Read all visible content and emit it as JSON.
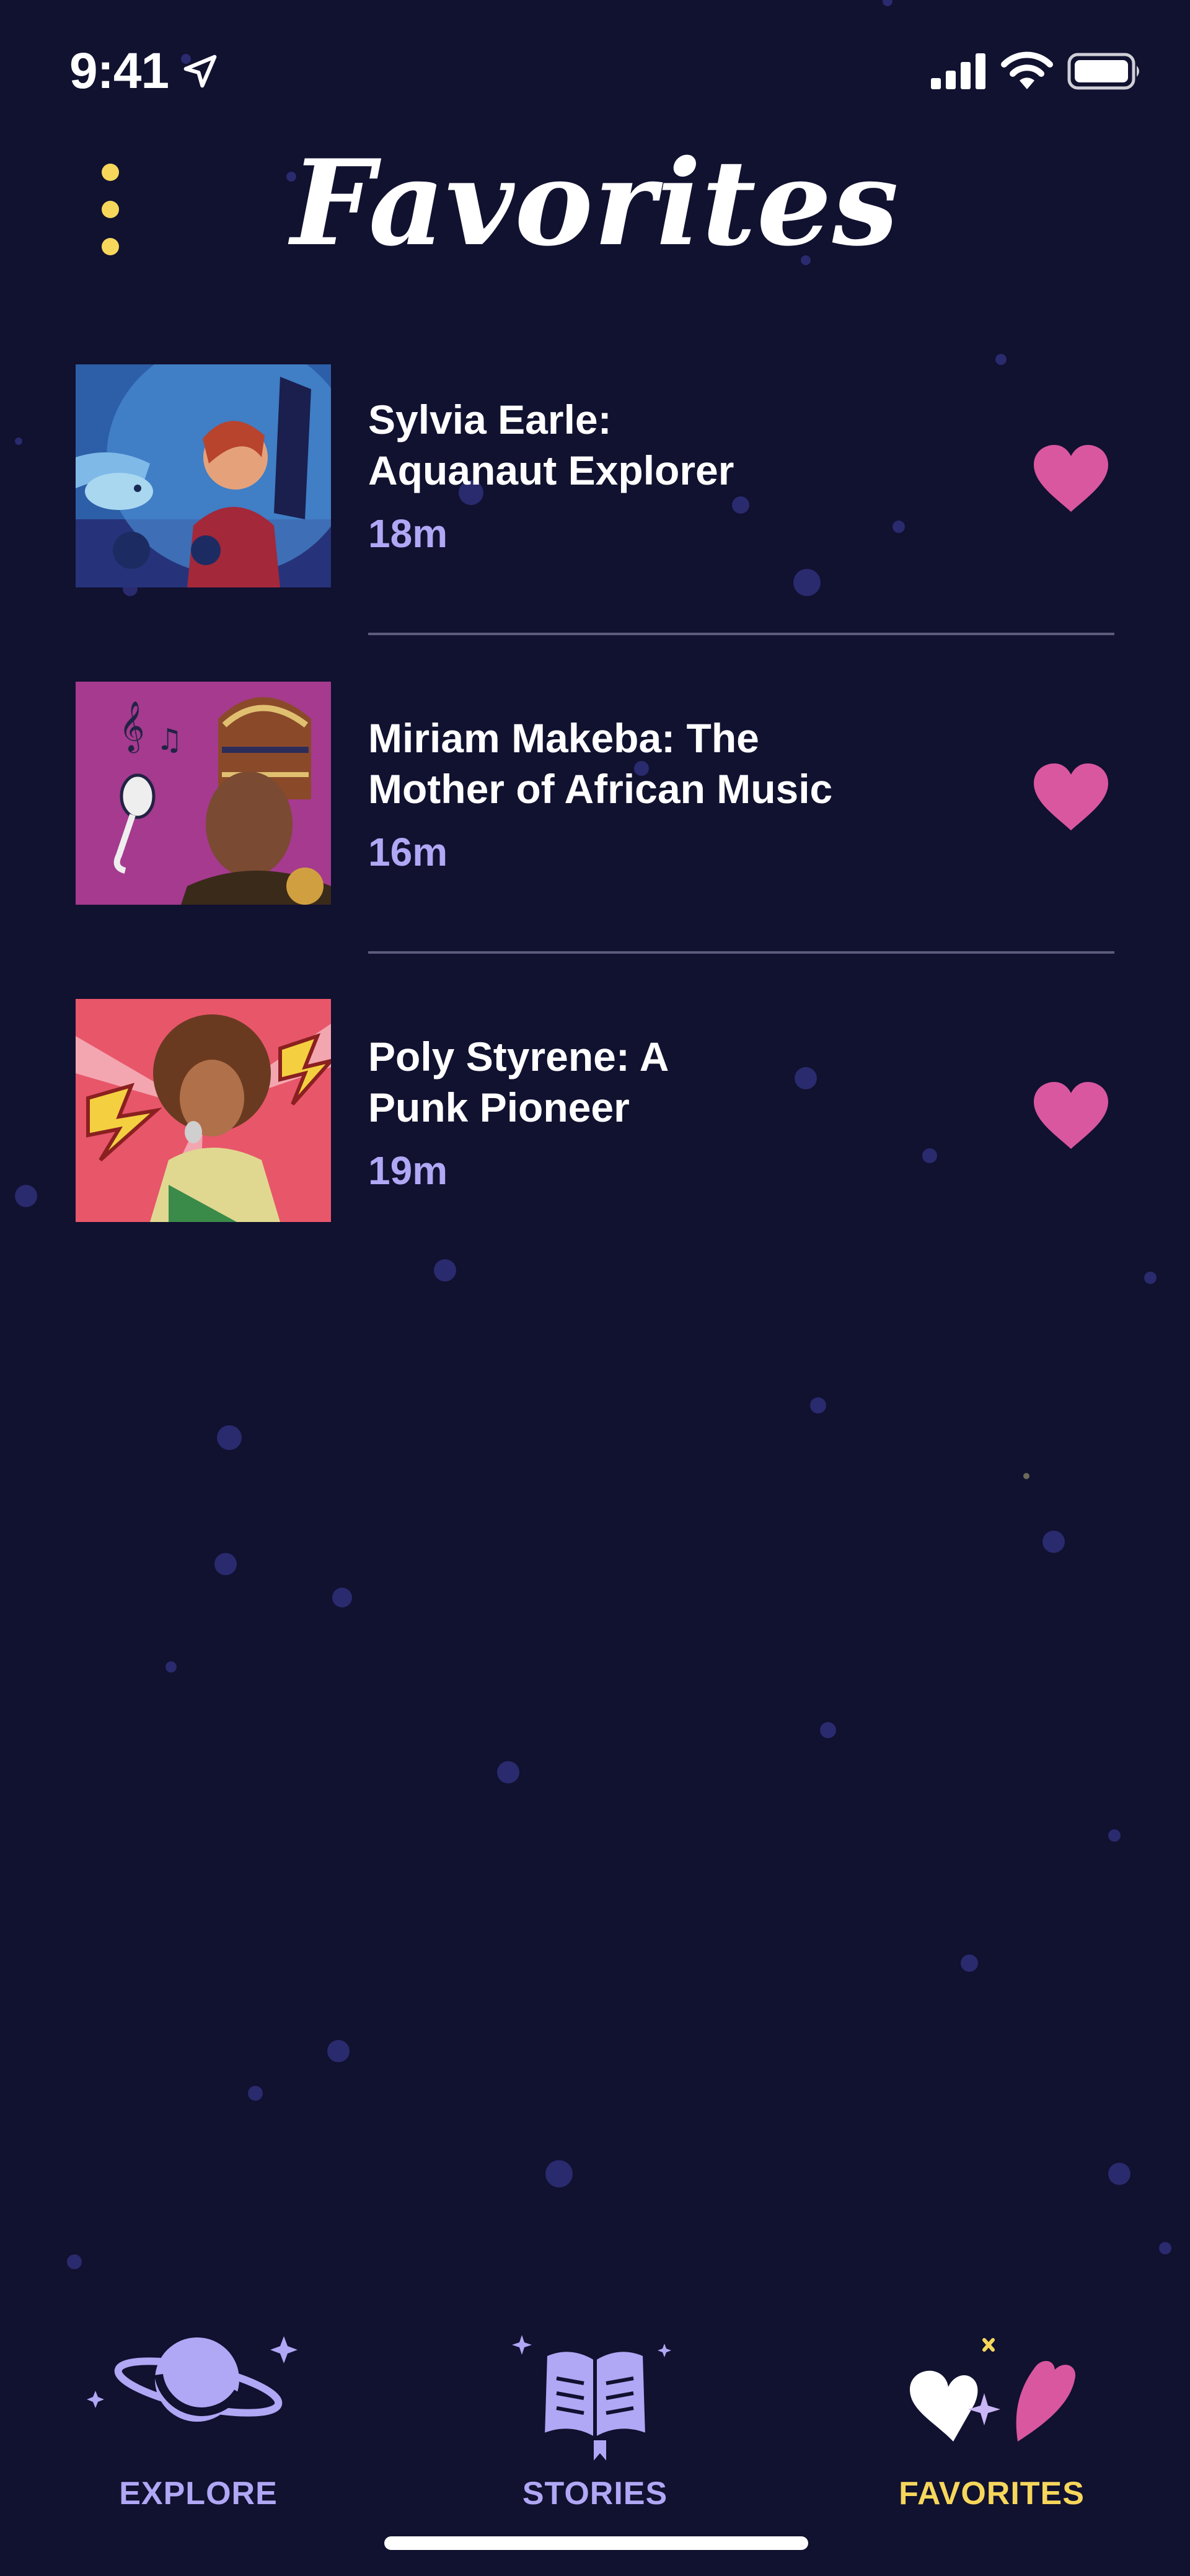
{
  "status_bar": {
    "time": "9:41",
    "icons": [
      "location-arrow-icon",
      "cellular-signal-icon",
      "wifi-icon",
      "battery-icon"
    ]
  },
  "header": {
    "title": "Favorites",
    "menu_icon": "vertical-dots-icon"
  },
  "favorites": [
    {
      "title": "Sylvia Earle:\nAquanaut Explorer",
      "duration": "18m",
      "thumbnail": "sylvia-earle-illustration",
      "favorited": true
    },
    {
      "title": "Miriam Makeba: The\nMother of African Music",
      "duration": "16m",
      "thumbnail": "miriam-makeba-illustration",
      "favorited": true
    },
    {
      "title": "Poly Styrene: A\nPunk Pioneer",
      "duration": "19m",
      "thumbnail": "poly-styrene-illustration",
      "favorited": true
    }
  ],
  "tab_bar": {
    "tabs": [
      {
        "label": "EXPLORE",
        "icon": "planet-icon",
        "active": false
      },
      {
        "label": "STORIES",
        "icon": "open-book-icon",
        "active": false
      },
      {
        "label": "FAVORITES",
        "icon": "hearts-icon",
        "active": true
      }
    ]
  },
  "colors": {
    "background": "#111130",
    "accent_yellow": "#f6d75b",
    "lavender": "#b0a7f5",
    "heart_pink": "#d9579f",
    "divider": "#5e5c7d"
  }
}
